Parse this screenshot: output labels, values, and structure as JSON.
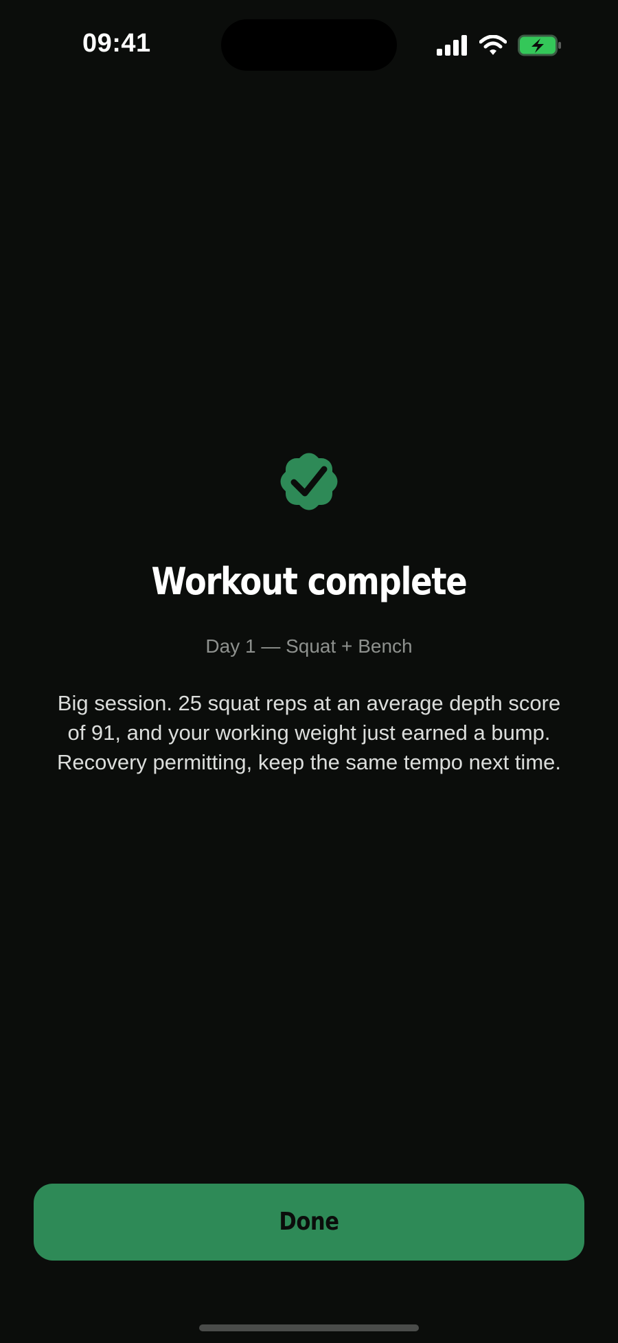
{
  "status_bar": {
    "time": "09:41",
    "icons": [
      "cellular-signal-icon",
      "wifi-icon",
      "battery-charging-icon"
    ]
  },
  "colors": {
    "background": "#0b0d0b",
    "accent": "#2e8a57",
    "battery": "#34c759"
  },
  "completion": {
    "badge_icon": "verified-check-badge-icon",
    "title": "Workout complete",
    "subtitle": "Day 1 — Squat + Bench",
    "message": "Big session. 25 squat reps at an average depth score of 91, and your working weight just earned a bump. Recovery permitting, keep the same tempo next time."
  },
  "actions": {
    "done_label": "Done"
  }
}
